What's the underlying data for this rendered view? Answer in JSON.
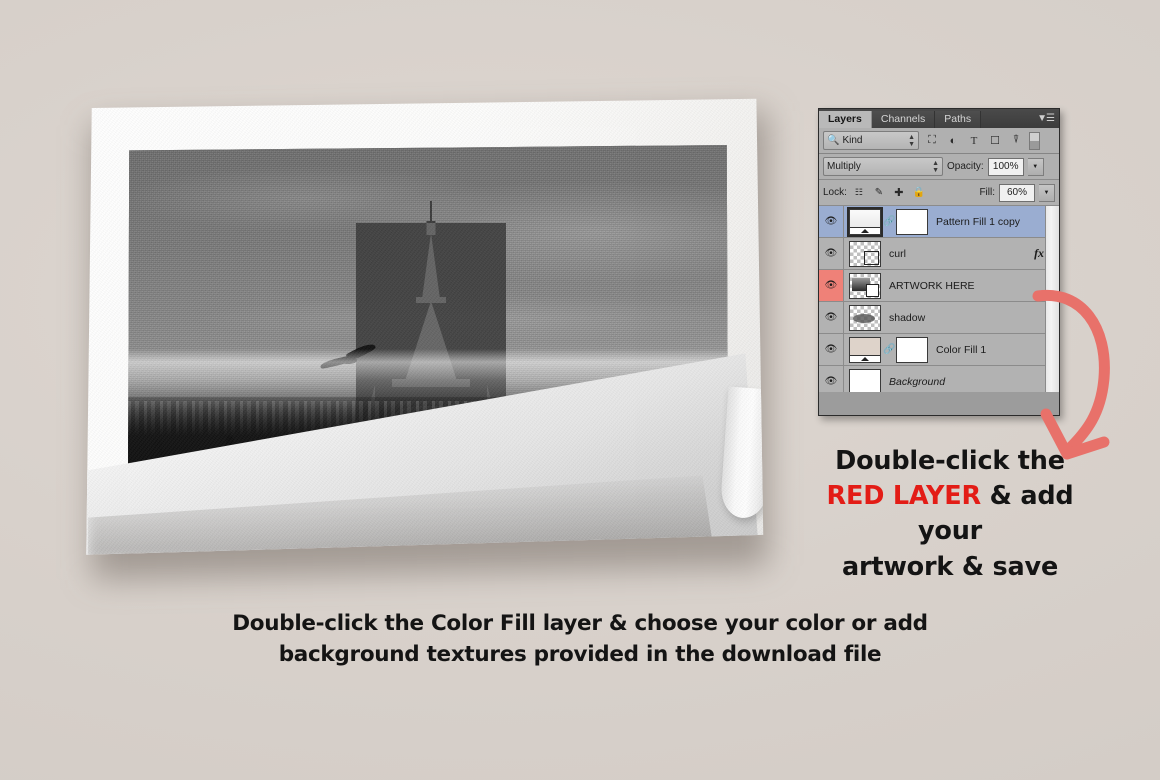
{
  "background": {
    "color": "#d8d1cb"
  },
  "poster": {
    "photo_subject": "eiffel-tower-black-and-white-photo",
    "alt": "Black and white photograph of the Eiffel Tower in Paris with a bird in flight"
  },
  "panel": {
    "tabs": [
      {
        "label": "Layers",
        "active": true
      },
      {
        "label": "Channels",
        "active": false
      },
      {
        "label": "Paths",
        "active": false
      }
    ],
    "menu_icon": "panel-menu-icon",
    "filter": {
      "search_icon": "magnifier-icon",
      "kind_label": "Kind",
      "icons": [
        "pixel-layer-icon",
        "adjustment-layer-icon",
        "type-layer-icon",
        "shape-layer-icon",
        "smart-object-icon"
      ]
    },
    "blend": {
      "mode": "Multiply",
      "opacity_label": "Opacity:",
      "opacity_value": "100%"
    },
    "lock": {
      "label": "Lock:",
      "icons": [
        "lock-transparency-icon",
        "lock-image-icon",
        "lock-position-icon",
        "lock-all-icon"
      ],
      "fill_label": "Fill:",
      "fill_value": "60%"
    },
    "layers": [
      {
        "name": "Pattern Fill 1 copy",
        "visible": true,
        "selected": true,
        "flagged": false,
        "thumb": "pattern-fill-thumbnail",
        "has_mask": true,
        "has_link": true,
        "has_fx": false,
        "locked": false,
        "italic": false
      },
      {
        "name": "curl",
        "visible": true,
        "selected": false,
        "flagged": false,
        "thumb": "transparent-curl-thumbnail",
        "has_mask": false,
        "has_link": false,
        "has_fx": true,
        "locked": false,
        "italic": false
      },
      {
        "name": "ARTWORK HERE",
        "visible": true,
        "selected": false,
        "flagged": true,
        "thumb": "smart-object-artwork-thumbnail",
        "has_mask": false,
        "has_link": false,
        "has_fx": false,
        "locked": false,
        "italic": false
      },
      {
        "name": "shadow",
        "visible": true,
        "selected": false,
        "flagged": false,
        "thumb": "transparent-shadow-thumbnail",
        "has_mask": false,
        "has_link": false,
        "has_fx": false,
        "locked": false,
        "italic": false
      },
      {
        "name": "Color Fill 1",
        "visible": true,
        "selected": false,
        "flagged": false,
        "thumb": "color-fill-thumbnail",
        "has_mask": true,
        "has_link": true,
        "has_fx": false,
        "locked": false,
        "italic": false
      },
      {
        "name": "Background",
        "visible": true,
        "selected": false,
        "flagged": false,
        "thumb": "background-white-thumbnail",
        "has_mask": false,
        "has_link": false,
        "has_fx": false,
        "locked": true,
        "italic": true
      }
    ]
  },
  "arrow": {
    "color": "#e8716a",
    "name": "curved-arrow-pointing-down"
  },
  "callout_right": {
    "line1": "Double-click the",
    "highlight": "RED LAYER",
    "line2_rest": " & add your",
    "line3": "artwork & save",
    "highlight_color": "#e31c16"
  },
  "callout_bottom": {
    "line1": "Double-click the Color Fill layer & choose  your color or add",
    "line2": "background textures provided in the download file"
  }
}
